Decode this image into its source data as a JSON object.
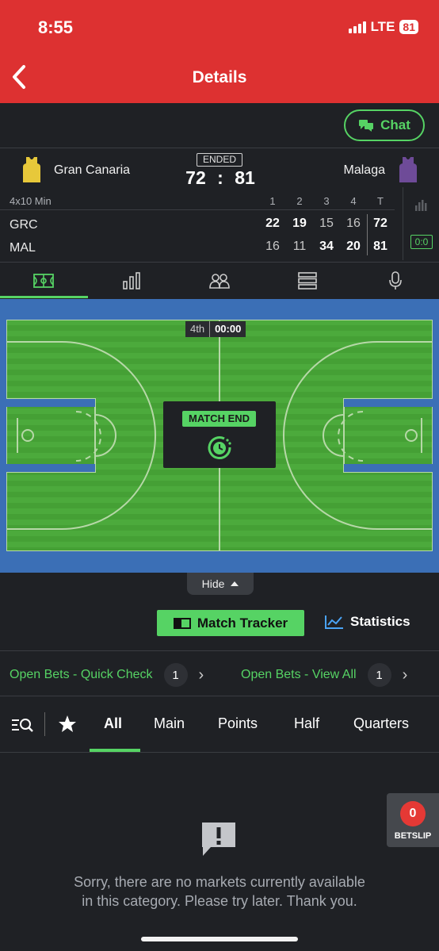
{
  "status_bar": {
    "time": "8:55",
    "network": "LTE",
    "battery": "81"
  },
  "header": {
    "title": "Details"
  },
  "chat": {
    "label": "Chat"
  },
  "match": {
    "status": "ENDED",
    "home_team": "Gran Canaria",
    "away_team": "Malaga",
    "home_score": "72",
    "away_score": "81",
    "separator": ":"
  },
  "boxscore": {
    "format": "4x10 Min",
    "headers": [
      "1",
      "2",
      "3",
      "4",
      "T"
    ],
    "rows": [
      {
        "team": "GRC",
        "values": [
          "22",
          "19",
          "15",
          "16",
          "72"
        ]
      },
      {
        "team": "MAL",
        "values": [
          "16",
          "11",
          "34",
          "20",
          "81"
        ]
      }
    ],
    "live_score": "0:0"
  },
  "tabs": [
    "court-icon",
    "bar-chart-icon",
    "lineup-icon",
    "table-icon",
    "microphone-icon"
  ],
  "court": {
    "quarter": "4th",
    "clock": "00:00",
    "status_badge": "MATCH END"
  },
  "hide": {
    "label": "Hide"
  },
  "actions": {
    "match_tracker": "Match Tracker",
    "statistics": "Statistics"
  },
  "open_bets": {
    "quick_check": {
      "label": "Open Bets - Quick Check",
      "count": "1"
    },
    "view_all": {
      "label": "Open Bets - View All",
      "count": "1"
    }
  },
  "market_tabs": [
    "All",
    "Main",
    "Points",
    "Half",
    "Quarters"
  ],
  "empty": {
    "message": "Sorry, there are no markets currently available in this category. Please try later. Thank you."
  },
  "betslip": {
    "count": "0",
    "label": "BETSLIP"
  },
  "colors": {
    "header_red": "#dd3131",
    "accent_green": "#56d364",
    "background": "#1f2125",
    "court_green": "#4aa83a",
    "court_blue": "#3b6fb6"
  }
}
